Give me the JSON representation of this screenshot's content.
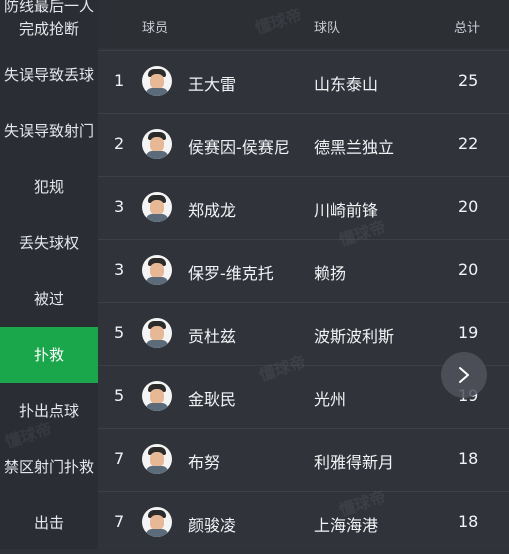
{
  "sidebar": {
    "items": [
      {
        "label": "防线最后一人"
      },
      {
        "label": "完成抢断"
      },
      {
        "label": "失误导致丢球"
      },
      {
        "label": "失误导致射门"
      },
      {
        "label": "犯规"
      },
      {
        "label": "丢失球权"
      },
      {
        "label": "被过"
      },
      {
        "label": "扑救"
      },
      {
        "label": "扑出点球"
      },
      {
        "label": "禁区射门扑救"
      },
      {
        "label": "出击"
      }
    ],
    "active": "扑救"
  },
  "table": {
    "headers": {
      "player": "球员",
      "team": "球队",
      "total": "总计"
    },
    "rows": [
      {
        "rank": "1",
        "player": "王大雷",
        "team": "山东泰山",
        "total": "25"
      },
      {
        "rank": "2",
        "player": "侯赛因-侯赛尼",
        "team": "德黑兰独立",
        "total": "22"
      },
      {
        "rank": "3",
        "player": "郑成龙",
        "team": "川崎前锋",
        "total": "20"
      },
      {
        "rank": "3",
        "player": "保罗-维克托",
        "team": "赖扬",
        "total": "20"
      },
      {
        "rank": "5",
        "player": "贡杜兹",
        "team": "波斯波利斯",
        "total": "19"
      },
      {
        "rank": "5",
        "player": "金耿民",
        "team": "光州",
        "total": "19"
      },
      {
        "rank": "7",
        "player": "布努",
        "team": "利雅得新月",
        "total": "18"
      },
      {
        "rank": "7",
        "player": "颜骏凌",
        "team": "上海海港",
        "total": "18"
      }
    ]
  },
  "watermark": "懂球帝",
  "icons": {
    "next": "chevron-right-icon",
    "avatar": "player-avatar-icon"
  },
  "colors": {
    "accent": "#1aa64a",
    "background": "#30343a",
    "sidebar": "#2a2d33"
  }
}
